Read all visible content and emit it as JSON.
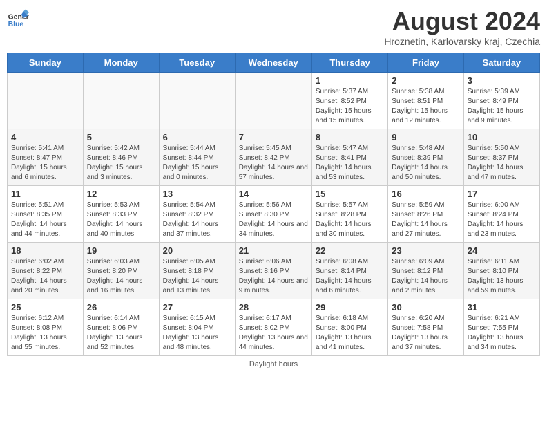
{
  "header": {
    "logo_general": "General",
    "logo_blue": "Blue",
    "month_year": "August 2024",
    "location": "Hroznetin, Karlovarsky kraj, Czechia"
  },
  "days_of_week": [
    "Sunday",
    "Monday",
    "Tuesday",
    "Wednesday",
    "Thursday",
    "Friday",
    "Saturday"
  ],
  "footer": {
    "note": "Daylight hours"
  },
  "weeks": [
    {
      "row_class": "row-odd",
      "days": [
        {
          "num": "",
          "info": ""
        },
        {
          "num": "",
          "info": ""
        },
        {
          "num": "",
          "info": ""
        },
        {
          "num": "",
          "info": ""
        },
        {
          "num": "1",
          "info": "Sunrise: 5:37 AM\nSunset: 8:52 PM\nDaylight: 15 hours and 15 minutes."
        },
        {
          "num": "2",
          "info": "Sunrise: 5:38 AM\nSunset: 8:51 PM\nDaylight: 15 hours and 12 minutes."
        },
        {
          "num": "3",
          "info": "Sunrise: 5:39 AM\nSunset: 8:49 PM\nDaylight: 15 hours and 9 minutes."
        }
      ]
    },
    {
      "row_class": "row-even",
      "days": [
        {
          "num": "4",
          "info": "Sunrise: 5:41 AM\nSunset: 8:47 PM\nDaylight: 15 hours and 6 minutes."
        },
        {
          "num": "5",
          "info": "Sunrise: 5:42 AM\nSunset: 8:46 PM\nDaylight: 15 hours and 3 minutes."
        },
        {
          "num": "6",
          "info": "Sunrise: 5:44 AM\nSunset: 8:44 PM\nDaylight: 15 hours and 0 minutes."
        },
        {
          "num": "7",
          "info": "Sunrise: 5:45 AM\nSunset: 8:42 PM\nDaylight: 14 hours and 57 minutes."
        },
        {
          "num": "8",
          "info": "Sunrise: 5:47 AM\nSunset: 8:41 PM\nDaylight: 14 hours and 53 minutes."
        },
        {
          "num": "9",
          "info": "Sunrise: 5:48 AM\nSunset: 8:39 PM\nDaylight: 14 hours and 50 minutes."
        },
        {
          "num": "10",
          "info": "Sunrise: 5:50 AM\nSunset: 8:37 PM\nDaylight: 14 hours and 47 minutes."
        }
      ]
    },
    {
      "row_class": "row-odd",
      "days": [
        {
          "num": "11",
          "info": "Sunrise: 5:51 AM\nSunset: 8:35 PM\nDaylight: 14 hours and 44 minutes."
        },
        {
          "num": "12",
          "info": "Sunrise: 5:53 AM\nSunset: 8:33 PM\nDaylight: 14 hours and 40 minutes."
        },
        {
          "num": "13",
          "info": "Sunrise: 5:54 AM\nSunset: 8:32 PM\nDaylight: 14 hours and 37 minutes."
        },
        {
          "num": "14",
          "info": "Sunrise: 5:56 AM\nSunset: 8:30 PM\nDaylight: 14 hours and 34 minutes."
        },
        {
          "num": "15",
          "info": "Sunrise: 5:57 AM\nSunset: 8:28 PM\nDaylight: 14 hours and 30 minutes."
        },
        {
          "num": "16",
          "info": "Sunrise: 5:59 AM\nSunset: 8:26 PM\nDaylight: 14 hours and 27 minutes."
        },
        {
          "num": "17",
          "info": "Sunrise: 6:00 AM\nSunset: 8:24 PM\nDaylight: 14 hours and 23 minutes."
        }
      ]
    },
    {
      "row_class": "row-even",
      "days": [
        {
          "num": "18",
          "info": "Sunrise: 6:02 AM\nSunset: 8:22 PM\nDaylight: 14 hours and 20 minutes."
        },
        {
          "num": "19",
          "info": "Sunrise: 6:03 AM\nSunset: 8:20 PM\nDaylight: 14 hours and 16 minutes."
        },
        {
          "num": "20",
          "info": "Sunrise: 6:05 AM\nSunset: 8:18 PM\nDaylight: 14 hours and 13 minutes."
        },
        {
          "num": "21",
          "info": "Sunrise: 6:06 AM\nSunset: 8:16 PM\nDaylight: 14 hours and 9 minutes."
        },
        {
          "num": "22",
          "info": "Sunrise: 6:08 AM\nSunset: 8:14 PM\nDaylight: 14 hours and 6 minutes."
        },
        {
          "num": "23",
          "info": "Sunrise: 6:09 AM\nSunset: 8:12 PM\nDaylight: 14 hours and 2 minutes."
        },
        {
          "num": "24",
          "info": "Sunrise: 6:11 AM\nSunset: 8:10 PM\nDaylight: 13 hours and 59 minutes."
        }
      ]
    },
    {
      "row_class": "row-odd",
      "days": [
        {
          "num": "25",
          "info": "Sunrise: 6:12 AM\nSunset: 8:08 PM\nDaylight: 13 hours and 55 minutes."
        },
        {
          "num": "26",
          "info": "Sunrise: 6:14 AM\nSunset: 8:06 PM\nDaylight: 13 hours and 52 minutes."
        },
        {
          "num": "27",
          "info": "Sunrise: 6:15 AM\nSunset: 8:04 PM\nDaylight: 13 hours and 48 minutes."
        },
        {
          "num": "28",
          "info": "Sunrise: 6:17 AM\nSunset: 8:02 PM\nDaylight: 13 hours and 44 minutes."
        },
        {
          "num": "29",
          "info": "Sunrise: 6:18 AM\nSunset: 8:00 PM\nDaylight: 13 hours and 41 minutes."
        },
        {
          "num": "30",
          "info": "Sunrise: 6:20 AM\nSunset: 7:58 PM\nDaylight: 13 hours and 37 minutes."
        },
        {
          "num": "31",
          "info": "Sunrise: 6:21 AM\nSunset: 7:55 PM\nDaylight: 13 hours and 34 minutes."
        }
      ]
    }
  ]
}
